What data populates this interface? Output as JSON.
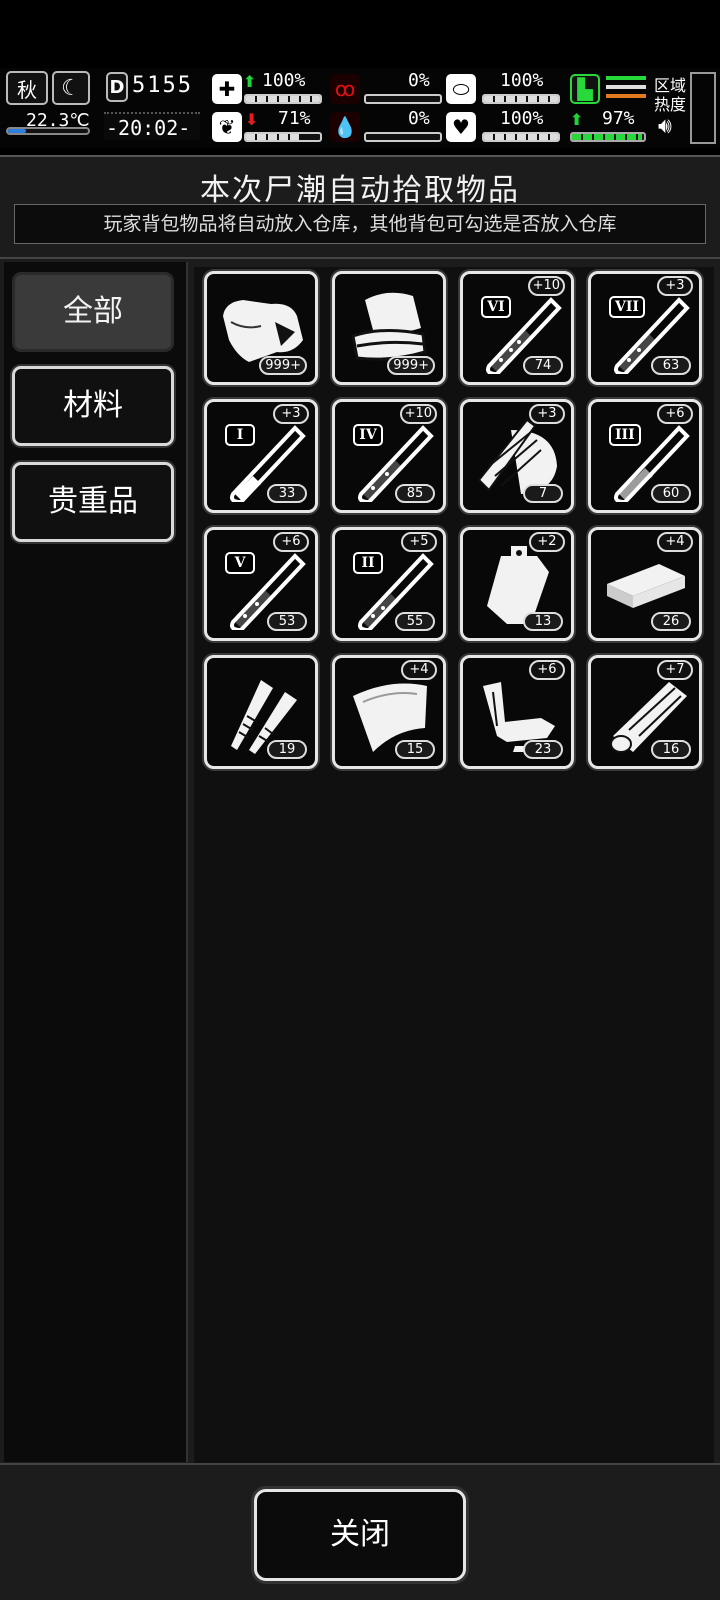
{
  "status": {
    "season": "秋",
    "temperature": "22.3℃",
    "day_counter": "5155",
    "clock": "-20:02-",
    "stats": [
      {
        "name": "health",
        "value": "100%",
        "trend": "up"
      },
      {
        "name": "hunger",
        "value": "0%"
      },
      {
        "name": "stamina",
        "value": "100%"
      },
      {
        "name": "mood",
        "value": "71%",
        "trend": "down"
      },
      {
        "name": "thirst",
        "value": "0%"
      },
      {
        "name": "heart",
        "value": "100%"
      },
      {
        "name": "energy",
        "value": "97%",
        "trend": "up"
      }
    ],
    "region_label": "区域热度"
  },
  "dialog": {
    "title": "本次尸潮自动拾取物品",
    "subtitle": "玩家背包物品将自动放入仓库，其他背包可勾选是否放入仓库"
  },
  "tabs": [
    {
      "label": "全部",
      "active": true
    },
    {
      "label": "材料",
      "active": false
    },
    {
      "label": "贵重品",
      "active": false
    }
  ],
  "items": [
    {
      "icon": "cloth-bag-icon",
      "count": "999+",
      "bonus": ""
    },
    {
      "icon": "folded-cloth-icon",
      "count": "999+",
      "bonus": ""
    },
    {
      "icon": "test-tube-icon",
      "roman": "VI",
      "count": "74",
      "bonus": "+10"
    },
    {
      "icon": "test-tube-icon",
      "roman": "VII",
      "count": "63",
      "bonus": "+3"
    },
    {
      "icon": "test-tube-icon",
      "roman": "I",
      "count": "33",
      "bonus": "+3"
    },
    {
      "icon": "test-tube-icon",
      "roman": "IV",
      "count": "85",
      "bonus": "+10"
    },
    {
      "icon": "wood-chips-icon",
      "count": "7",
      "bonus": "+3"
    },
    {
      "icon": "test-tube-icon",
      "roman": "III",
      "count": "60",
      "bonus": "+6"
    },
    {
      "icon": "test-tube-icon",
      "roman": "V",
      "count": "53",
      "bonus": "+6"
    },
    {
      "icon": "test-tube-icon",
      "roman": "II",
      "count": "55",
      "bonus": "+5"
    },
    {
      "icon": "iv-bag-icon",
      "count": "13",
      "bonus": "+2"
    },
    {
      "icon": "metal-ingot-icon",
      "count": "26",
      "bonus": "+4"
    },
    {
      "icon": "screws-icon",
      "count": "19",
      "bonus": ""
    },
    {
      "icon": "leather-sheet-icon",
      "count": "15",
      "bonus": "+4"
    },
    {
      "icon": "scrap-parts-icon",
      "count": "23",
      "bonus": "+6"
    },
    {
      "icon": "wood-log-icon",
      "count": "16",
      "bonus": "+7"
    }
  ],
  "footer": {
    "close_label": "关闭"
  }
}
